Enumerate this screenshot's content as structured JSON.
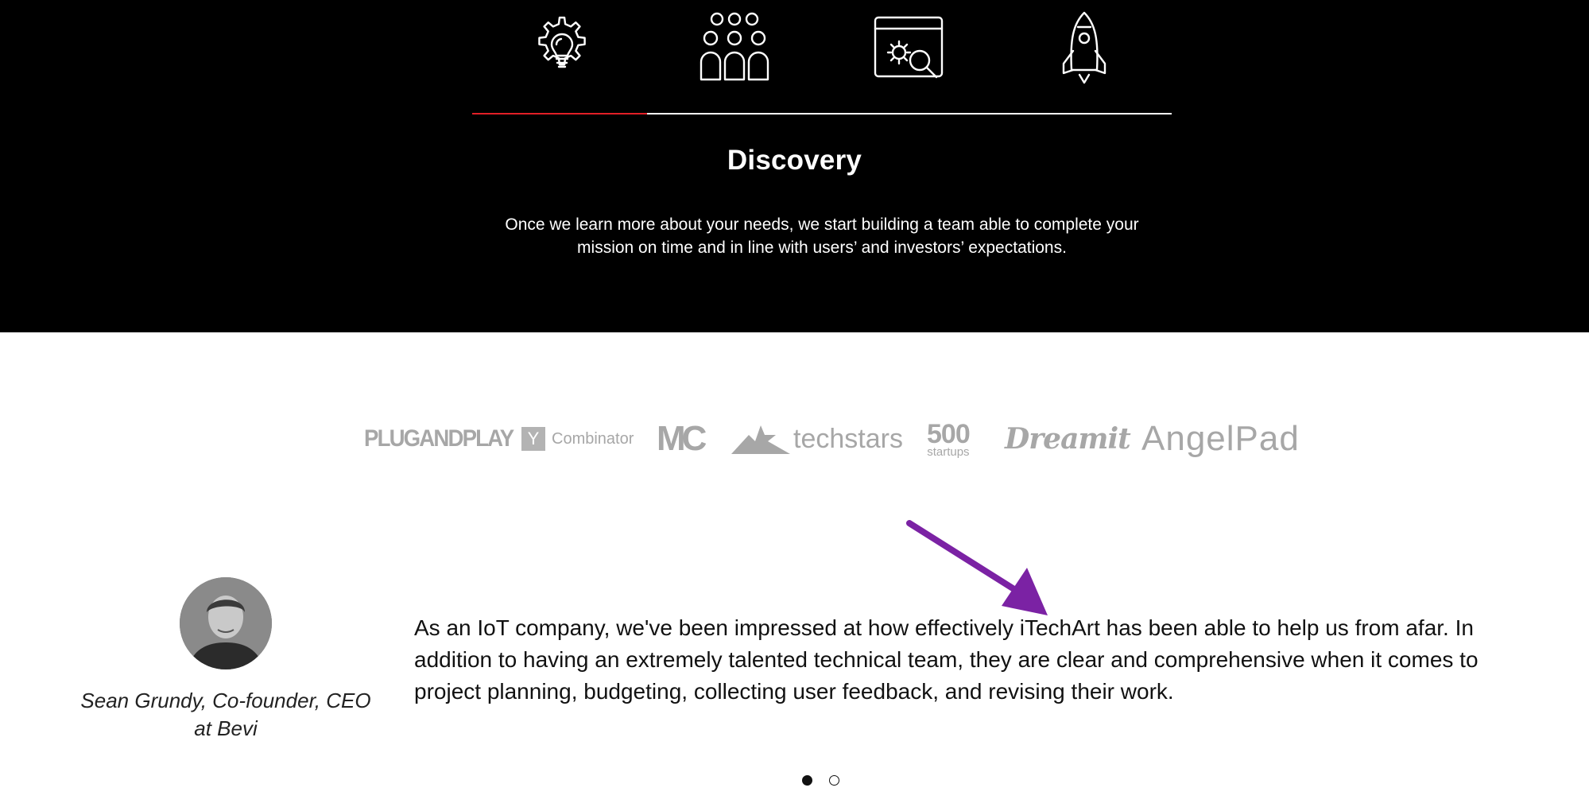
{
  "process": {
    "steps": [
      {
        "icon": "lightbulb-gear-icon"
      },
      {
        "icon": "team-icon"
      },
      {
        "icon": "browser-settings-search-icon"
      },
      {
        "icon": "rocket-icon"
      }
    ],
    "active_step": 1,
    "total_steps": 4,
    "title": "Discovery",
    "description": "Once we learn more about your needs, we start building a team able to complete your mission on time and in line with users’ and investors’ expectations.",
    "colors": {
      "background": "#000000",
      "accent": "#e11f26",
      "text": "#ffffff"
    }
  },
  "logos": {
    "plugandplay": "PLUGANDPLAY",
    "ycombinator_mark": "Y",
    "ycombinator_text": "Combinator",
    "mc": "MC",
    "techstars": "techstars",
    "startups_number": "500",
    "startups_text": "startups",
    "dreamit": "Dreamit",
    "angelpad": "AngelPad",
    "color": "#a7a7a7"
  },
  "annotation": {
    "arrow_color": "#7b22a4"
  },
  "testimonial": {
    "author": "Sean Grundy, Co-founder, CEO at Bevi",
    "quote": "As an IoT company, we've been impressed at how effectively iTechArt has been able to help us from afar. In addition to having an extremely talented technical team, they are clear and comprehensive when it comes to project planning, budgeting, collecting user feedback, and revising their work."
  },
  "carousel": {
    "total": 2,
    "active": 1
  }
}
